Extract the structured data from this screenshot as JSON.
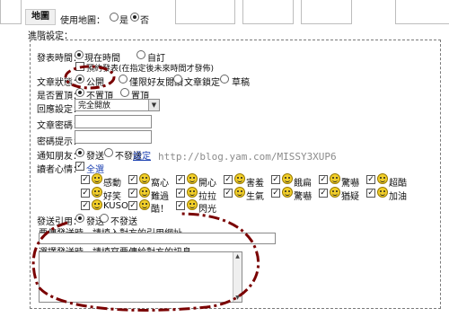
{
  "header": {
    "tab_label": "地圖",
    "use_map_label": "使用地圖：",
    "option_yes": "是",
    "option_no": "否"
  },
  "section_title": "進階設定：",
  "publish_time": {
    "label": "發表時間：",
    "opt_now": "現在時間",
    "opt_custom": "自訂",
    "note": "預約發表(在指定後未來時間才發佈)"
  },
  "post_status": {
    "label": "文章狀態：",
    "opt_public": "公開",
    "opt_friends": "僅限好友閱讀",
    "opt_protected": "文章鎖定",
    "opt_draft": "草稿"
  },
  "pin_top": {
    "label": "是否置頂：",
    "opt_no": "不置頂",
    "opt_yes": "置頂"
  },
  "permission": {
    "label": "回應設定：",
    "value": "完全開放"
  },
  "password": {
    "label": "文章密碼："
  },
  "password_hint": {
    "label": "密碼提示："
  },
  "notify_friends": {
    "label": "通知朋友：",
    "opt_notify": "發送",
    "opt_no_notify": "不發送",
    "settings_link": "設定"
  },
  "reader_mood": {
    "label": "讀者心情：",
    "select_all": "全選",
    "moods": [
      "感動",
      "窩心",
      "開心",
      "害羞",
      "餓扁",
      "驚嚇",
      "超酷",
      "好笑",
      "難過",
      "拉拉",
      "生氣",
      "驚嚇",
      "猶疑",
      "加油",
      "KUSO",
      "酷！",
      "閃光"
    ]
  },
  "trackback": {
    "label": "發送引用：",
    "opt_send": "發送",
    "opt_no_send": "不發送",
    "url_label": "要傳發送時，請填入對方的引用網址",
    "msg_label": "選擇發送時，請填寫要傳給對方的訊息"
  },
  "watermark": "http://blog.yam.com/MISSY3XUP6",
  "colors": {
    "highlight": "#7a0000",
    "link": "#1a3fb0",
    "border": "#9b9b9b"
  }
}
